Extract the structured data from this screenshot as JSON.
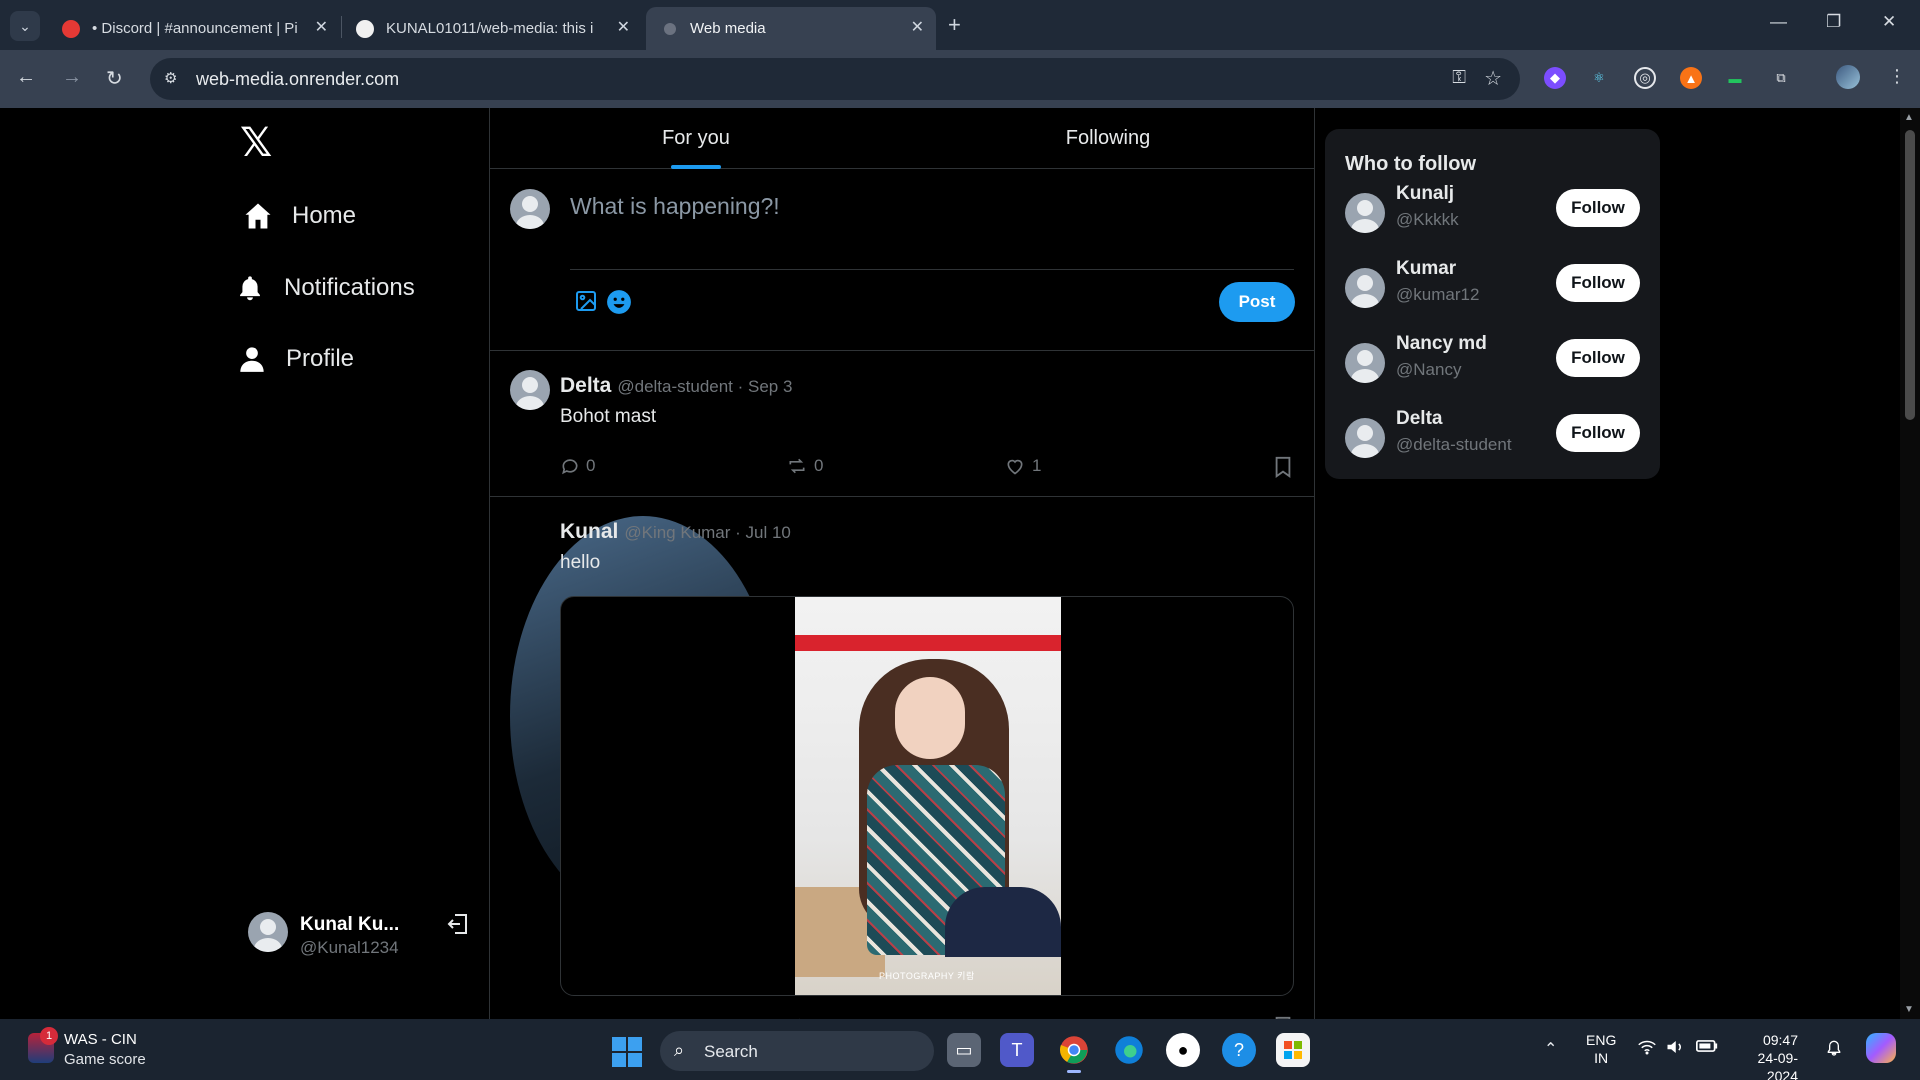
{
  "browser": {
    "tabs": [
      {
        "title": "• Discord | #announcement | Pi",
        "active": false
      },
      {
        "title": "KUNAL01011/web-media: this i",
        "active": false
      },
      {
        "title": "Web media",
        "active": true
      }
    ],
    "tab_close": "✕",
    "new_tab": "+",
    "url": "web-media.onrender.com",
    "window_controls": {
      "minimize": "—",
      "restore": "❐",
      "close": "✕"
    }
  },
  "sidebar": {
    "logo": "𝕏",
    "nav": [
      {
        "label": "Home",
        "icon": "home-icon"
      },
      {
        "label": "Notifications",
        "icon": "bell-icon"
      },
      {
        "label": "Profile",
        "icon": "person-icon"
      }
    ],
    "account": {
      "name": "Kunal Ku...",
      "handle": "@Kunal1234"
    }
  },
  "feed": {
    "tabs": [
      {
        "label": "For you",
        "active": true
      },
      {
        "label": "Following",
        "active": false
      }
    ],
    "composer": {
      "placeholder": "What is happening?!",
      "post_label": "Post"
    },
    "posts": [
      {
        "name": "Delta",
        "meta": "@delta-student · Sep 3",
        "text": "Bohot mast",
        "replies": "0",
        "reposts": "0",
        "likes": "1",
        "has_image": false
      },
      {
        "name": "Kunal",
        "meta": "@King Kumar · Jul 10",
        "text": "hello",
        "image_caption": "PHOTOGRAPHY 키람",
        "has_image": true
      }
    ]
  },
  "who_to_follow": {
    "title": "Who to follow",
    "follow_label": "Follow",
    "users": [
      {
        "name": "Kunalj",
        "handle": "@Kkkkk"
      },
      {
        "name": "Kumar",
        "handle": "@kumar12"
      },
      {
        "name": "Nancy md",
        "handle": "@Nancy"
      },
      {
        "name": "Delta",
        "handle": "@delta-student"
      }
    ]
  },
  "taskbar": {
    "widget_badge": "1",
    "widget_title": "WAS - CIN",
    "widget_subtitle": "Game score",
    "search_label": "Search",
    "lang_top": "ENG",
    "lang_bottom": "IN",
    "time": "09:47",
    "date": "24-09-2024"
  },
  "colors": {
    "accent": "#1d9bf0",
    "background": "#000000",
    "card": "#16181c",
    "muted_text": "#71767b"
  }
}
